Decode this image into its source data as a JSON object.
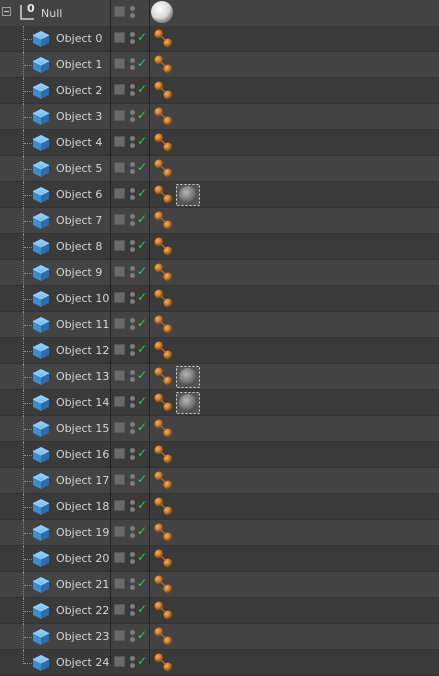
{
  "parent": {
    "name": "Null",
    "badge": "0",
    "icon": "null-object-icon",
    "tag": "material-tag-white"
  },
  "objects": [
    {
      "name": "Object 0",
      "material": false
    },
    {
      "name": "Object 1",
      "material": false
    },
    {
      "name": "Object 2",
      "material": false
    },
    {
      "name": "Object 3",
      "material": false
    },
    {
      "name": "Object 4",
      "material": false
    },
    {
      "name": "Object 5",
      "material": false
    },
    {
      "name": "Object 6",
      "material": true
    },
    {
      "name": "Object 7",
      "material": false
    },
    {
      "name": "Object 8",
      "material": false
    },
    {
      "name": "Object 9",
      "material": false
    },
    {
      "name": "Object 10",
      "material": false
    },
    {
      "name": "Object 11",
      "material": false
    },
    {
      "name": "Object 12",
      "material": false
    },
    {
      "name": "Object 13",
      "material": true
    },
    {
      "name": "Object 14",
      "material": true
    },
    {
      "name": "Object 15",
      "material": false
    },
    {
      "name": "Object 16",
      "material": false
    },
    {
      "name": "Object 17",
      "material": false
    },
    {
      "name": "Object 18",
      "material": false
    },
    {
      "name": "Object 19",
      "material": false
    },
    {
      "name": "Object 20",
      "material": false
    },
    {
      "name": "Object 21",
      "material": false
    },
    {
      "name": "Object 22",
      "material": false
    },
    {
      "name": "Object 23",
      "material": false
    },
    {
      "name": "Object 24",
      "material": false
    }
  ],
  "icons": {
    "object": "cube-icon",
    "enabled": "checkmark-icon",
    "tag": "phong-tag-icon",
    "material": "material-tag-icon"
  },
  "colors": {
    "background": "#3e3e3e",
    "cube": "#4a9fdc",
    "check": "#35c75a",
    "phong": "#c77a2a"
  }
}
